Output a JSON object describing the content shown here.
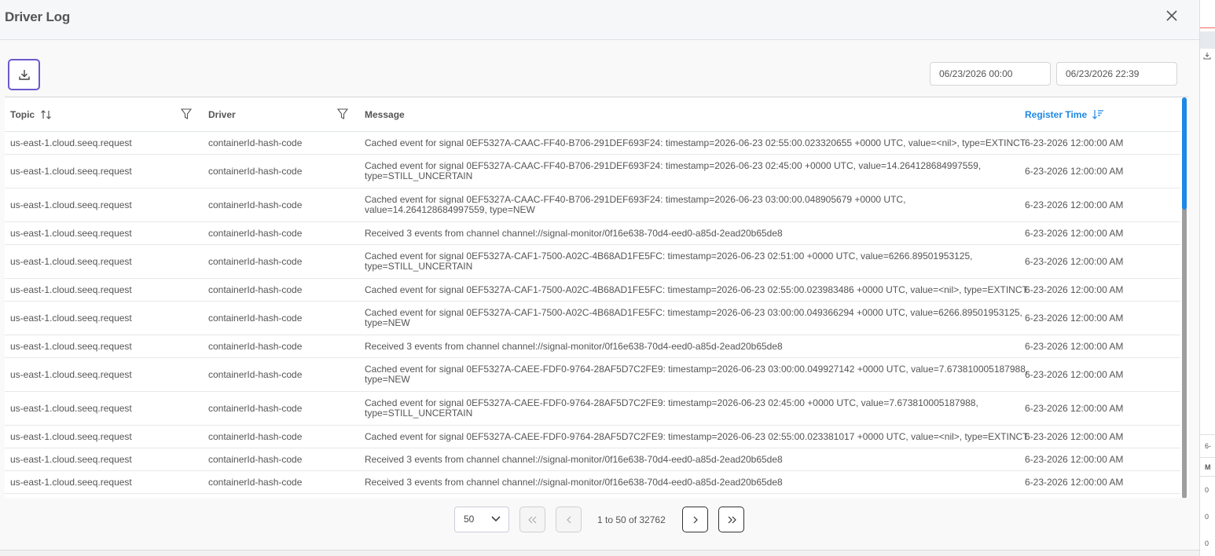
{
  "modal": {
    "title": "Driver Log"
  },
  "toolbar": {
    "download_icon": "download-icon",
    "date_from": "06/23/2026 00:00",
    "date_to": "06/23/2026 22:39"
  },
  "table": {
    "columns": [
      {
        "label": "Topic",
        "icon": "sort-updown-icon"
      },
      {
        "label": "Driver",
        "icon": "filter-icon"
      },
      {
        "label": "Message",
        "icon": "filter-icon"
      },
      {
        "label": "Register Time",
        "icon": "sort-descending-icon"
      }
    ],
    "rows": [
      {
        "topic": "us-east-1.cloud.seeq.request",
        "driver": "containerId-hash-code",
        "message": "Cached event for signal 0EF5327A-CAAC-FF40-B706-291DEF693F24: timestamp=2026-06-23 02:55:00.023320655 +0000 UTC, value=<nil>, type=EXTINCT",
        "time": "6-23-2026 12:00:00 AM"
      },
      {
        "topic": "us-east-1.cloud.seeq.request",
        "driver": "containerId-hash-code",
        "message": "Cached event for signal 0EF5327A-CAAC-FF40-B706-291DEF693F24: timestamp=2026-06-23 02:45:00 +0000 UTC, value=14.264128684997559,\ntype=STILL_UNCERTAIN",
        "time": "6-23-2026 12:00:00 AM"
      },
      {
        "topic": "us-east-1.cloud.seeq.request",
        "driver": "containerId-hash-code",
        "message": "Cached event for signal 0EF5327A-CAAC-FF40-B706-291DEF693F24: timestamp=2026-06-23 03:00:00.048905679 +0000 UTC,\nvalue=14.264128684997559, type=NEW",
        "time": "6-23-2026 12:00:00 AM"
      },
      {
        "topic": "us-east-1.cloud.seeq.request",
        "driver": "containerId-hash-code",
        "message": "Received 3 events from channel channel://signal-monitor/0f16e638-70d4-eed0-a85d-2ead20b65de8",
        "time": "6-23-2026 12:00:00 AM"
      },
      {
        "topic": "us-east-1.cloud.seeq.request",
        "driver": "containerId-hash-code",
        "message": "Cached event for signal 0EF5327A-CAF1-7500-A02C-4B68AD1FE5FC: timestamp=2026-06-23 02:51:00 +0000 UTC, value=6266.89501953125,\ntype=STILL_UNCERTAIN",
        "time": "6-23-2026 12:00:00 AM"
      },
      {
        "topic": "us-east-1.cloud.seeq.request",
        "driver": "containerId-hash-code",
        "message": "Cached event for signal 0EF5327A-CAF1-7500-A02C-4B68AD1FE5FC: timestamp=2026-06-23 02:55:00.023983486 +0000 UTC, value=<nil>, type=EXTINCT",
        "time": "6-23-2026 12:00:00 AM"
      },
      {
        "topic": "us-east-1.cloud.seeq.request",
        "driver": "containerId-hash-code",
        "message": "Cached event for signal 0EF5327A-CAF1-7500-A02C-4B68AD1FE5FC: timestamp=2026-06-23 03:00:00.049366294 +0000 UTC, value=6266.89501953125,\ntype=NEW",
        "time": "6-23-2026 12:00:00 AM"
      },
      {
        "topic": "us-east-1.cloud.seeq.request",
        "driver": "containerId-hash-code",
        "message": "Received 3 events from channel channel://signal-monitor/0f16e638-70d4-eed0-a85d-2ead20b65de8",
        "time": "6-23-2026 12:00:00 AM"
      },
      {
        "topic": "us-east-1.cloud.seeq.request",
        "driver": "containerId-hash-code",
        "message": "Cached event for signal 0EF5327A-CAEE-FDF0-9764-28AF5D7C2FE9: timestamp=2026-06-23 03:00:00.049927142 +0000 UTC, value=7.673810005187988,\ntype=NEW",
        "time": "6-23-2026 12:00:00 AM"
      },
      {
        "topic": "us-east-1.cloud.seeq.request",
        "driver": "containerId-hash-code",
        "message": "Cached event for signal 0EF5327A-CAEE-FDF0-9764-28AF5D7C2FE9: timestamp=2026-06-23 02:45:00 +0000 UTC, value=7.673810005187988,\ntype=STILL_UNCERTAIN",
        "time": "6-23-2026 12:00:00 AM"
      },
      {
        "topic": "us-east-1.cloud.seeq.request",
        "driver": "containerId-hash-code",
        "message": "Cached event for signal 0EF5327A-CAEE-FDF0-9764-28AF5D7C2FE9: timestamp=2026-06-23 02:55:00.023381017 +0000 UTC, value=<nil>, type=EXTINCT",
        "time": "6-23-2026 12:00:00 AM"
      },
      {
        "topic": "us-east-1.cloud.seeq.request",
        "driver": "containerId-hash-code",
        "message": "Received 3 events from channel channel://signal-monitor/0f16e638-70d4-eed0-a85d-2ead20b65de8",
        "time": "6-23-2026 12:00:00 AM"
      },
      {
        "topic": "us-east-1.cloud.seeq.request",
        "driver": "containerId-hash-code",
        "message": "Received 3 events from channel channel://signal-monitor/0f16e638-70d4-eed0-a85d-2ead20b65de8",
        "time": "6-23-2026 12:00:00 AM"
      }
    ]
  },
  "pagination": {
    "page_size": "50",
    "summary": "1 to 50 of 32762"
  },
  "background_app": {
    "side_labels": [
      "6-",
      "M",
      "0",
      "0",
      "0"
    ]
  },
  "colors": {
    "accent": "#1e88e5",
    "focus_outline": "#6a5acd"
  }
}
